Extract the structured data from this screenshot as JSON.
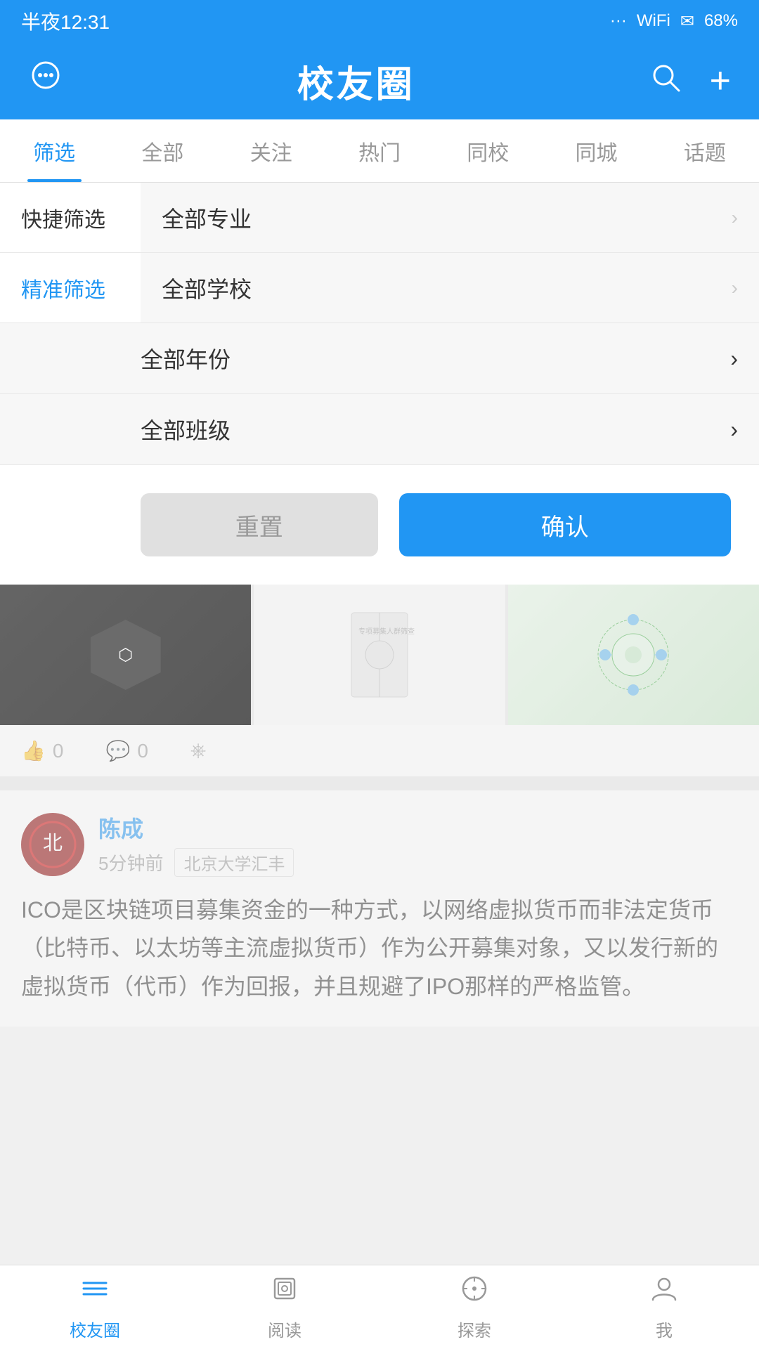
{
  "statusBar": {
    "time": "半夜12:31",
    "battery": "68%",
    "signal": "..."
  },
  "header": {
    "title": "校友圈",
    "msgIcon": "💬",
    "searchIcon": "search",
    "addIcon": "+"
  },
  "tabs": [
    {
      "id": "filter",
      "label": "筛选",
      "active": true
    },
    {
      "id": "all",
      "label": "全部",
      "active": false
    },
    {
      "id": "follow",
      "label": "关注",
      "active": false
    },
    {
      "id": "hot",
      "label": "热门",
      "active": false
    },
    {
      "id": "school",
      "label": "同校",
      "active": false
    },
    {
      "id": "city",
      "label": "同城",
      "active": false
    },
    {
      "id": "topic",
      "label": "话题",
      "active": false
    }
  ],
  "filterPanel": {
    "quickFilter": {
      "label": "快捷筛选",
      "option": "全部专业"
    },
    "preciseFilter": {
      "label": "精准筛选",
      "rows": [
        {
          "id": "school",
          "value": "全部学校"
        },
        {
          "id": "year",
          "value": "全部年份"
        },
        {
          "id": "class",
          "value": "全部班级"
        }
      ]
    },
    "resetButton": "重置",
    "confirmButton": "确认"
  },
  "bgPost": {
    "likeCount": "0",
    "commentCount": "0"
  },
  "post": {
    "author": "陈成",
    "timeAgo": "5分钟前",
    "tag": "北京大学汇丰",
    "content": "ICO是区块链项目募集资金的一种方式，以网络虚拟货币而非法定货币（比特币、以太坊等主流虚拟货币）作为公开募集对象，又以发行新的虚拟货币（代币）作为回报，并且规避了IPO那样的严格监管。"
  },
  "bottomNav": [
    {
      "id": "home",
      "label": "校友圈",
      "active": true,
      "icon": "≡"
    },
    {
      "id": "read",
      "label": "阅读",
      "active": false,
      "icon": "◈"
    },
    {
      "id": "explore",
      "label": "探索",
      "active": false,
      "icon": "◎"
    },
    {
      "id": "me",
      "label": "我",
      "active": false,
      "icon": "◯"
    }
  ],
  "colors": {
    "primary": "#2196F3",
    "active_tab": "#2196F3",
    "inactive_tab": "#999999"
  }
}
